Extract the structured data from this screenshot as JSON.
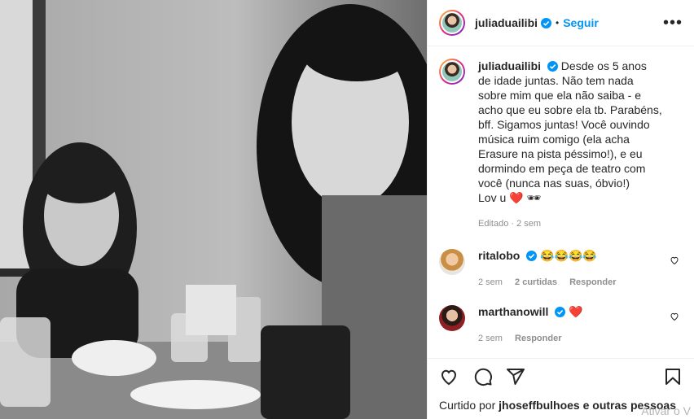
{
  "post": {
    "username": "juliaduailibi",
    "follow_label": "Seguir",
    "dot": "•",
    "more_label": "•••"
  },
  "caption": {
    "username": "juliaduailibi",
    "text": "Desde os 5 anos de idade juntas. Não tem nada sobre mim que ela não saiba - e acho que eu sobre ela tb. Parabéns, bff. Sigamos juntas! Você ouvindo música ruim comigo (ela acha Erasure na pista péssimo!), e eu dormindo em peça de teatro com você (nunca nas suas, óbvio!)",
    "signoff": "Lov u ❤️ 🕶",
    "meta": "Editado · 2 sem"
  },
  "comments": [
    {
      "username": "ritalobo",
      "text": "😂😂😂😂",
      "time": "2 sem",
      "likes": "2 curtidas",
      "reply": "Responder"
    },
    {
      "username": "marthanowill",
      "text": "❤️",
      "time": "2 sem",
      "reply": "Responder"
    }
  ],
  "likes": {
    "prefix": "Curtido por",
    "user": "jhoseffbulhoes",
    "suffix": "e outras pessoas"
  },
  "watermark": "Ativar o V",
  "colors": {
    "accent": "#0095f6",
    "verified": "#0095f6",
    "heart": "#ed4956"
  },
  "icons": [
    "verified-badge-icon",
    "more-options-icon",
    "heart-icon",
    "comment-icon",
    "share-icon",
    "bookmark-icon"
  ]
}
